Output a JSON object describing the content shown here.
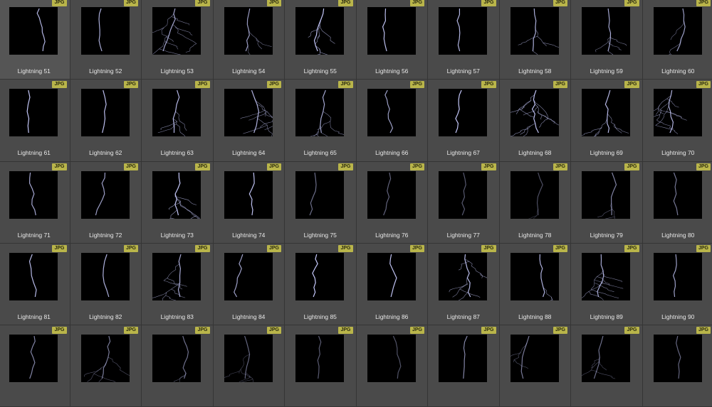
{
  "badge_text": "JPG",
  "bolt_color": "#c9ccff",
  "items": [
    {
      "label": "Lightning 51"
    },
    {
      "label": "Lightning 52"
    },
    {
      "label": "Lightning 53"
    },
    {
      "label": "Lightning 54"
    },
    {
      "label": "Lightning 55"
    },
    {
      "label": "Lightning 56"
    },
    {
      "label": "Lightning 57"
    },
    {
      "label": "Lightning 58"
    },
    {
      "label": "Lightning 59"
    },
    {
      "label": "Lightning 60"
    },
    {
      "label": "Lightning 61"
    },
    {
      "label": "Lightning 62"
    },
    {
      "label": "Lightning 63"
    },
    {
      "label": "Lightning 64"
    },
    {
      "label": "Lightning 65"
    },
    {
      "label": "Lightning 66"
    },
    {
      "label": "Lightning 67"
    },
    {
      "label": "Lightning 68"
    },
    {
      "label": "Lightning 69"
    },
    {
      "label": "Lightning 70"
    },
    {
      "label": "Lightning 71"
    },
    {
      "label": "Lightning 72"
    },
    {
      "label": "Lightning 73"
    },
    {
      "label": "Lightning 74"
    },
    {
      "label": "Lightning 75"
    },
    {
      "label": "Lightning 76"
    },
    {
      "label": "Lightning 77"
    },
    {
      "label": "Lightning 78"
    },
    {
      "label": "Lightning 79"
    },
    {
      "label": "Lightning 80"
    },
    {
      "label": "Lightning 81"
    },
    {
      "label": "Lightning 82"
    },
    {
      "label": "Lightning 83"
    },
    {
      "label": "Lightning 84"
    },
    {
      "label": "Lightning 85"
    },
    {
      "label": "Lightning 86"
    },
    {
      "label": "Lightning 87"
    },
    {
      "label": "Lightning 88"
    },
    {
      "label": "Lightning 89"
    },
    {
      "label": "Lightning 90"
    },
    {
      "label": ""
    },
    {
      "label": ""
    },
    {
      "label": ""
    },
    {
      "label": ""
    },
    {
      "label": ""
    },
    {
      "label": ""
    },
    {
      "label": ""
    },
    {
      "label": ""
    },
    {
      "label": ""
    },
    {
      "label": ""
    }
  ]
}
